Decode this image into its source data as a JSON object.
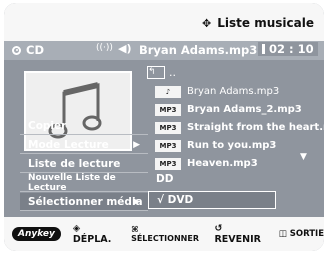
{
  "header": {
    "title": "Liste musicale",
    "title_icon": "diamond-icon"
  },
  "status": {
    "source": "CD",
    "file_name": "Bryan Adams.mp3",
    "time": "02 : 10"
  },
  "file_list": {
    "parent_folder_label": "..",
    "items": [
      {
        "type": "♪",
        "name": "Bryan Adams.mp3"
      },
      {
        "type": "MP3",
        "name": "Bryan Adams_2.mp3"
      },
      {
        "type": "MP3",
        "name": "Straight from the heart.mp3"
      },
      {
        "type": "MP3",
        "name": "Run to you.mp3"
      },
      {
        "type": "MP3",
        "name": "Heaven.mp3"
      }
    ]
  },
  "context_menu": {
    "items": [
      {
        "label": "Copier"
      },
      {
        "label": "Mode Lecture",
        "arrow": "▶"
      },
      {
        "label": "Liste de lecture"
      },
      {
        "label": "Nouvelle Liste de Lecture"
      },
      {
        "label": "Sélectionner média",
        "arrow": "▶"
      }
    ]
  },
  "submenu": {
    "options": [
      {
        "label": "DD"
      },
      {
        "label": "√ DVD"
      }
    ]
  },
  "bottom_bar": {
    "anykey": "Anykey",
    "move": "DÉPLA.",
    "select": "SÉLECTIONNER",
    "back": "REVENIR",
    "exit": "SORTIE"
  },
  "colors": {
    "panel_bg": "#8f959e",
    "bar_bg": "#f7f7f7",
    "highlight": "#7a8089"
  }
}
